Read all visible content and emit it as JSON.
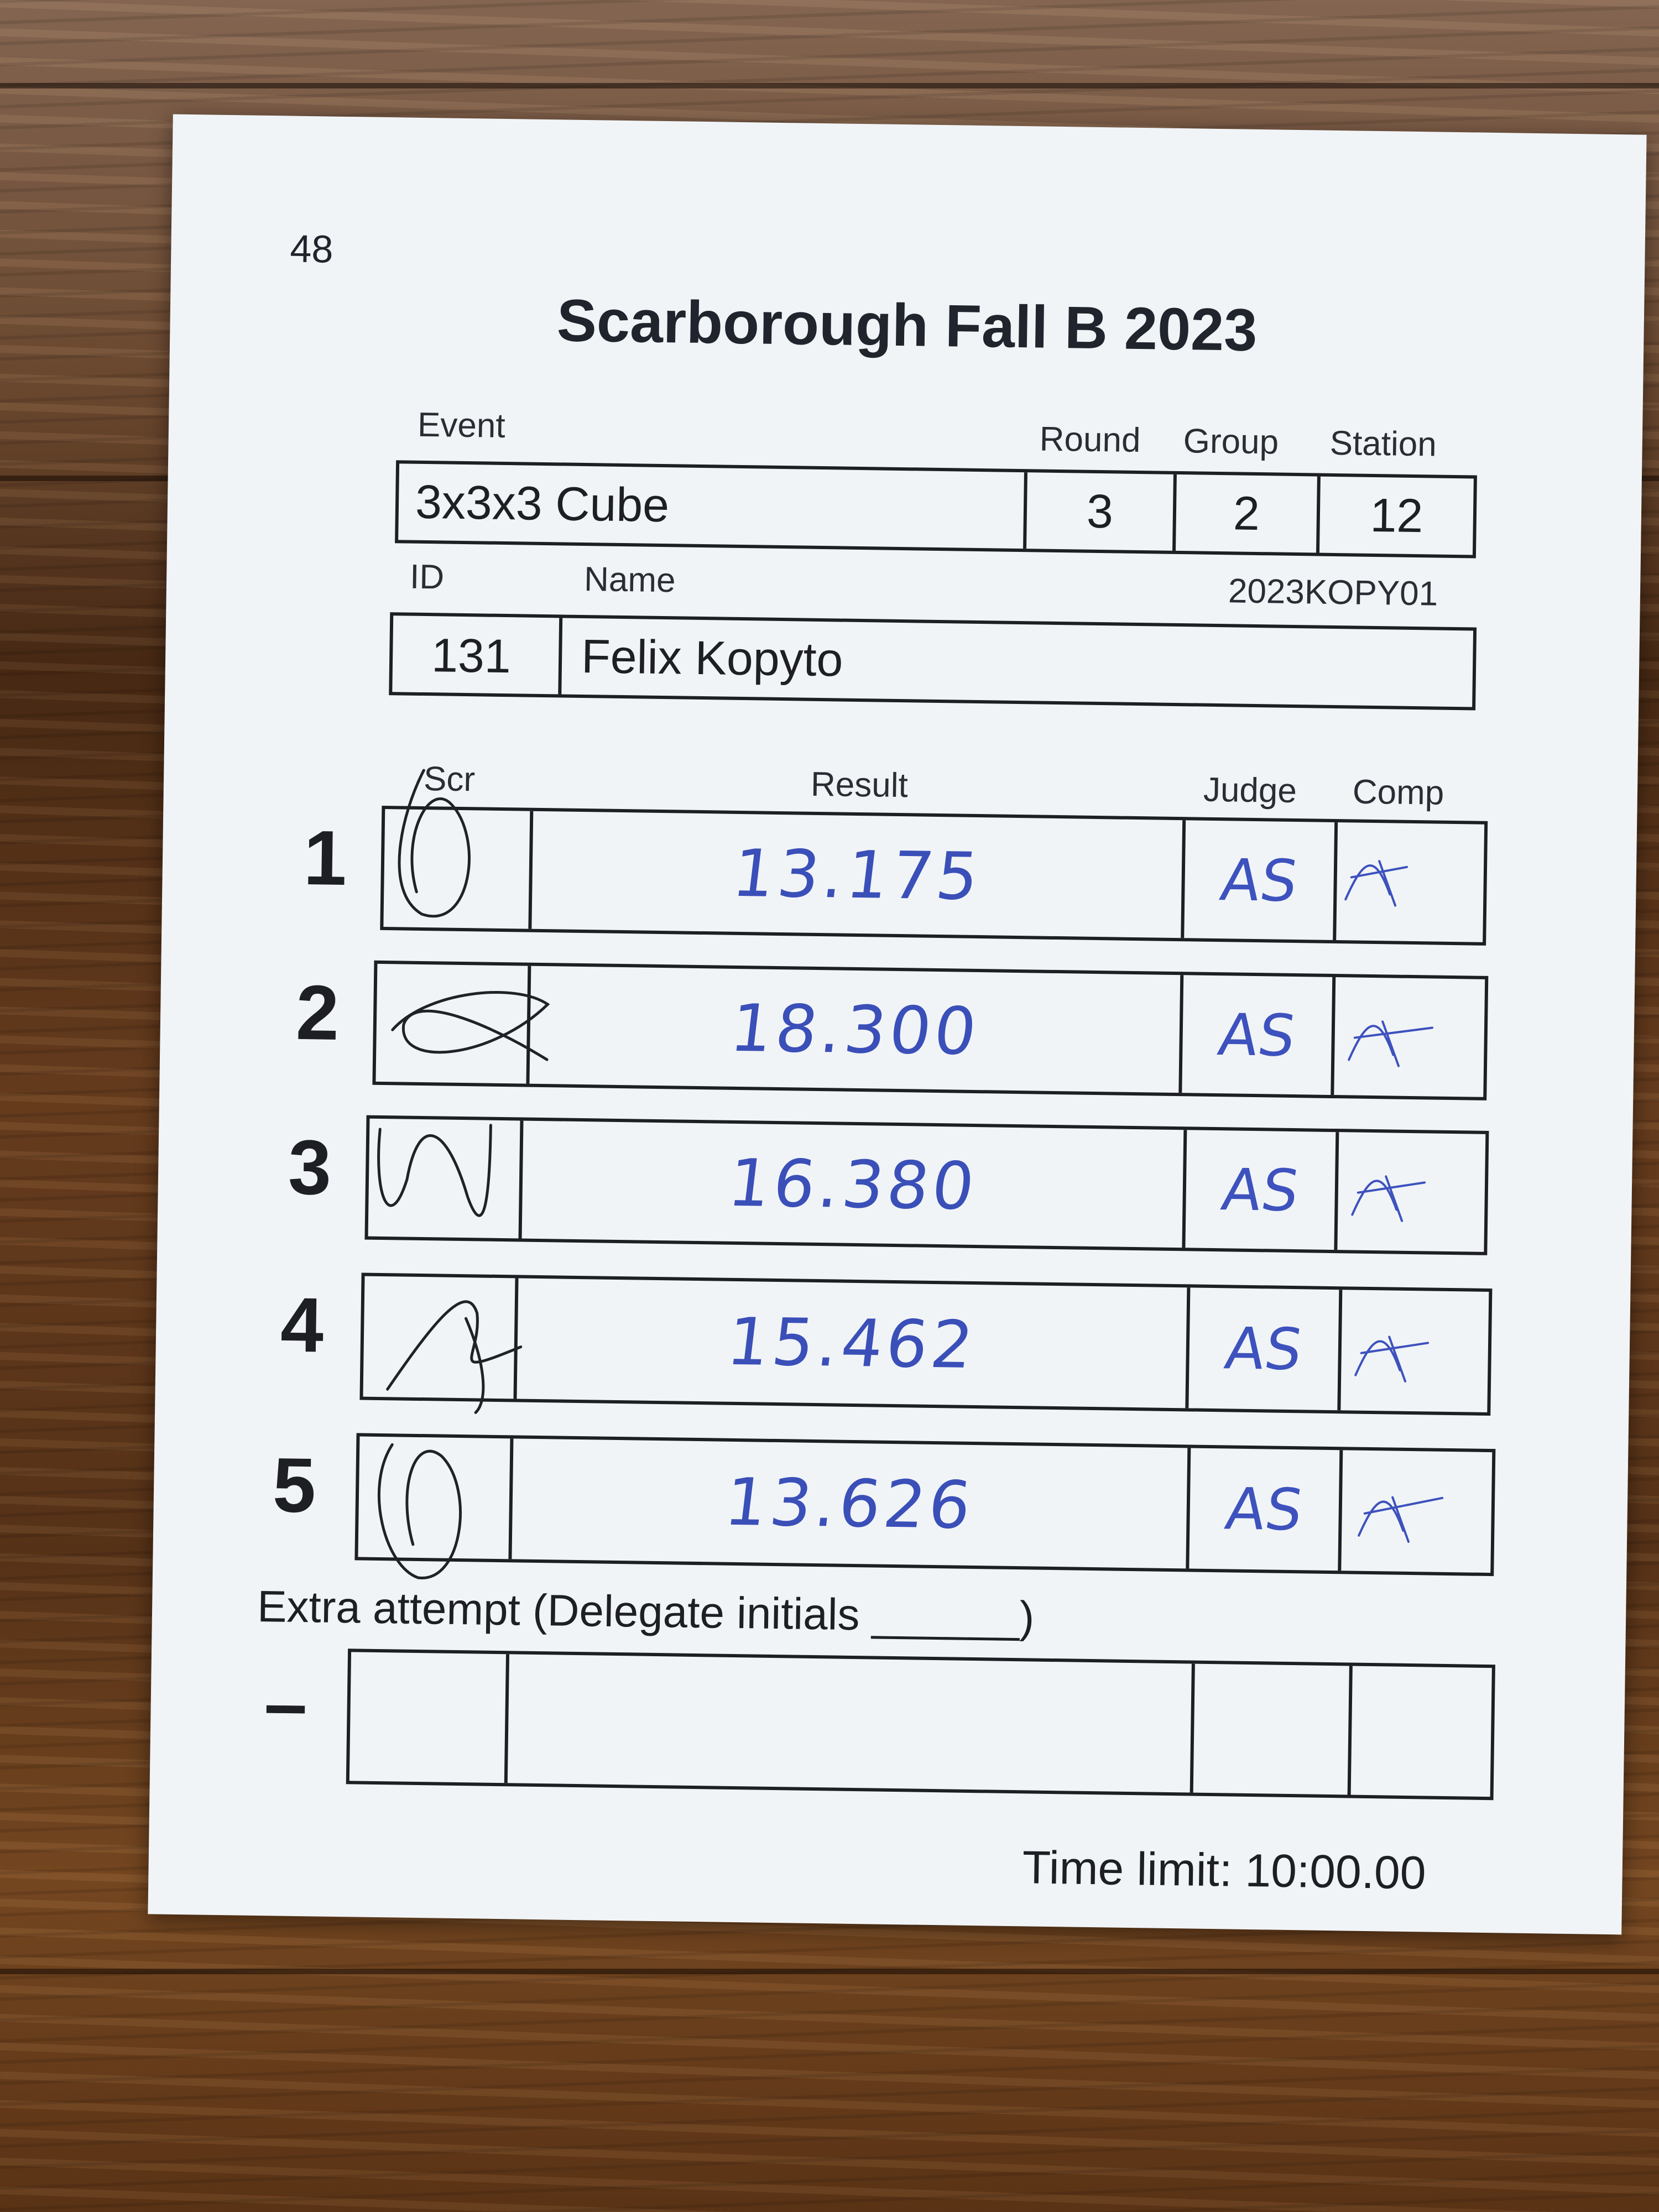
{
  "sheet": {
    "page_number": "48",
    "title": "Scarborough Fall B 2023",
    "headers": {
      "event": "Event",
      "round": "Round",
      "group": "Group",
      "station": "Station",
      "id": "ID",
      "name": "Name",
      "scr": "Scr",
      "result": "Result",
      "judge": "Judge",
      "comp": "Comp"
    },
    "event": "3x3x3 Cube",
    "round": "3",
    "group": "2",
    "station": "12",
    "competitor_id": "131",
    "competitor_name": "Felix Kopyto",
    "wca_id": "2023KOPY01",
    "attempts": [
      {
        "num": "1",
        "result": "13.175",
        "judge": "AS"
      },
      {
        "num": "2",
        "result": "18.300",
        "judge": "AS"
      },
      {
        "num": "3",
        "result": "16.380",
        "judge": "AS"
      },
      {
        "num": "4",
        "result": "15.462",
        "judge": "AS"
      },
      {
        "num": "5",
        "result": "13.626",
        "judge": "AS"
      }
    ],
    "extra_attempt_label": "Extra attempt (Delegate initials ______)",
    "extra_attempt_num": "–",
    "time_limit": "Time limit: 10:00.00"
  },
  "colors": {
    "paper": "#f1f4f7",
    "ink": "#1d1f24",
    "pen_blue": "#3a4fb8",
    "signature_black": "#1f2328"
  }
}
